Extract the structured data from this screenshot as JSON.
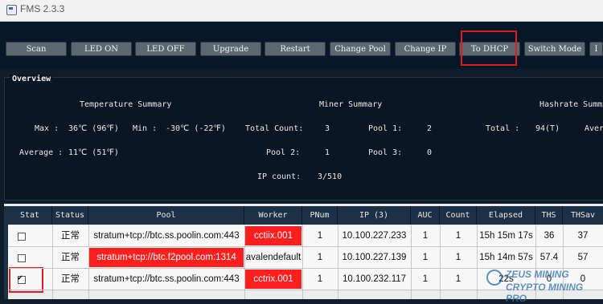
{
  "window": {
    "title": "FMS 2.3.3"
  },
  "toolbar": {
    "buttons": [
      "Scan",
      "LED ON",
      "LED OFF",
      "Upgrade",
      "Restart",
      "Change Pool",
      "Change IP",
      "To DHCP",
      "Switch Mode",
      "I"
    ]
  },
  "overview": {
    "title": "Overview",
    "temperature": {
      "heading": "Temperature Summary",
      "max_label": "Max :",
      "max_value": "36℃ (96℉)",
      "min_label": "Min :",
      "min_value": "-30℃ (-22℉)",
      "avg_label": "Average :",
      "avg_value": "11℃ (51℉)"
    },
    "miner": {
      "heading": "Miner Summary",
      "total_label": "Total Count:",
      "total_value": "3",
      "pool1_label": "Pool 1:",
      "pool1_value": "2",
      "pool2_label": "Pool 2:",
      "pool2_value": "1",
      "pool3_label": "Pool 3:",
      "pool3_value": "0",
      "ip_label": "IP count:",
      "ip_value": "3/510"
    },
    "hashrate": {
      "heading": "Hashrate Summar",
      "total_label": "Total :",
      "total_value": "94(T)",
      "avg_label": "Aver"
    }
  },
  "table": {
    "headers": [
      "Stat",
      "Status",
      "Pool",
      "Worker",
      "PNum",
      "IP (3)",
      "AUC",
      "Count",
      "Elapsed",
      "THS",
      "THSav"
    ],
    "rows": [
      {
        "checked": false,
        "status": "正常",
        "pool": "stratum+tcp://btc.ss.poolin.com:443",
        "worker": "cctiix.001",
        "pnum": "1",
        "ip": "10.100.227.233",
        "auc": "1",
        "count": "1",
        "elapsed": "15h 15m 17s",
        "ths": "36",
        "thsav": "37",
        "pool_red": false
      },
      {
        "checked": false,
        "status": "正常",
        "pool": "stratum+tcp://btc.f2pool.com:1314",
        "worker": "avalendefault",
        "pnum": "1",
        "ip": "10.100.227.139",
        "auc": "1",
        "count": "1",
        "elapsed": "15h 14m 57s",
        "ths": "57.4",
        "thsav": "57",
        "pool_red": true
      },
      {
        "checked": true,
        "status": "正常",
        "pool": "stratum+tcp://btc.ss.poolin.com:443",
        "worker": "cctrix.001",
        "pnum": "1",
        "ip": "10.100.232.117",
        "auc": "1",
        "count": "1",
        "elapsed": "22s",
        "ths": "0",
        "thsav": "0",
        "pool_red": false
      }
    ]
  },
  "watermark": {
    "line1": "ZEUS MINING",
    "line2": "CRYPTO MINING PRO"
  }
}
